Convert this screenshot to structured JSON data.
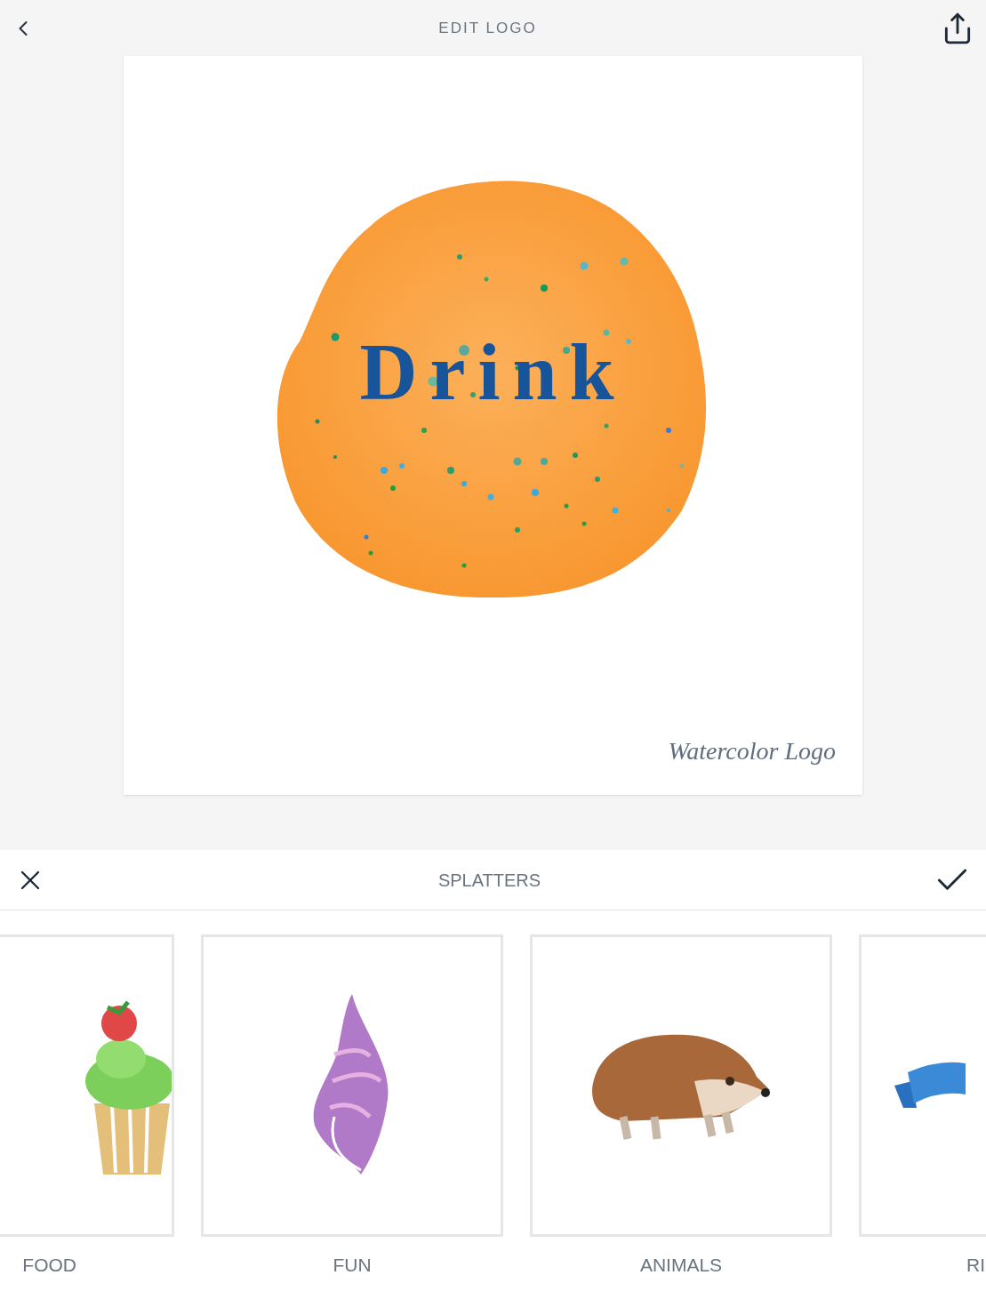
{
  "header": {
    "title": "EDIT LOGO"
  },
  "logo": {
    "text": "Drink",
    "signature": "Watercolor Logo"
  },
  "sheet": {
    "title": "SPLATTERS"
  },
  "categories": [
    {
      "label": "FOOD",
      "kind": "cupcake"
    },
    {
      "label": "FUN",
      "kind": "shell"
    },
    {
      "label": "ANIMALS",
      "kind": "hedgehog"
    },
    {
      "label": "RI",
      "kind": "ribbon"
    }
  ]
}
